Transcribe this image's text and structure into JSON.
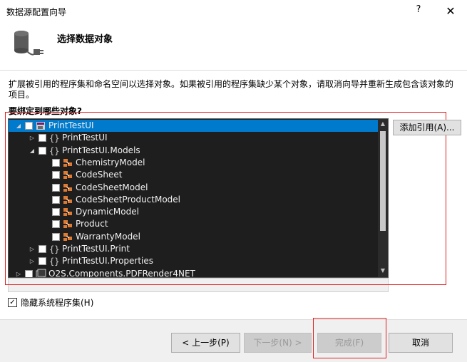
{
  "window": {
    "title": "数据源配置向导",
    "help_glyph": "?",
    "close_glyph": "✕"
  },
  "header": {
    "heading": "选择数据对象",
    "icon": "database-connector-icon"
  },
  "description": "扩展被引用的程序集和命名空间以选择对象。如果被引用的程序集缺少某个对象，请取消向导并重新生成包含该对象的项目。",
  "question": "要绑定到哪些对象?",
  "tree": {
    "items": [
      {
        "label": "PrintTestUI",
        "level": 0,
        "expander": "expanded",
        "icon": "project-icon",
        "selected": true
      },
      {
        "label": "PrintTestUI",
        "level": 1,
        "expander": "collapsed",
        "icon": "namespace-icon",
        "selected": false
      },
      {
        "label": "PrintTestUI.Models",
        "level": 1,
        "expander": "expanded",
        "icon": "namespace-icon",
        "selected": false
      },
      {
        "label": "ChemistryModel",
        "level": 2,
        "expander": "none",
        "icon": "class-icon",
        "selected": false
      },
      {
        "label": "CodeSheet",
        "level": 2,
        "expander": "none",
        "icon": "class-icon",
        "selected": false
      },
      {
        "label": "CodeSheetModel",
        "level": 2,
        "expander": "none",
        "icon": "class-icon",
        "selected": false
      },
      {
        "label": "CodeSheetProductModel",
        "level": 2,
        "expander": "none",
        "icon": "class-icon",
        "selected": false
      },
      {
        "label": "DynamicModel",
        "level": 2,
        "expander": "none",
        "icon": "class-icon",
        "selected": false
      },
      {
        "label": "Product",
        "level": 2,
        "expander": "none",
        "icon": "class-icon",
        "selected": false
      },
      {
        "label": "WarrantyModel",
        "level": 2,
        "expander": "none",
        "icon": "class-icon",
        "selected": false
      },
      {
        "label": "PrintTestUI.Print",
        "level": 1,
        "expander": "collapsed",
        "icon": "namespace-icon",
        "selected": false
      },
      {
        "label": "PrintTestUI.Properties",
        "level": 1,
        "expander": "collapsed",
        "icon": "namespace-icon",
        "selected": false
      },
      {
        "label": "O2S.Components.PDFRender4NET",
        "level": 0,
        "expander": "collapsed",
        "icon": "assembly-icon",
        "selected": false
      }
    ]
  },
  "add_reference_label": "添加引用(A)...",
  "hide_system_assemblies": {
    "label": "隐藏系统程序集(H)",
    "checked": true
  },
  "buttons": {
    "previous": "< 上一步(P)",
    "next": "下一步(N) >",
    "finish": "完成(F)",
    "cancel": "取消"
  },
  "colors": {
    "tree_background": "#1e1e1e",
    "selection": "#007acc",
    "highlight_border": "#e02020"
  }
}
